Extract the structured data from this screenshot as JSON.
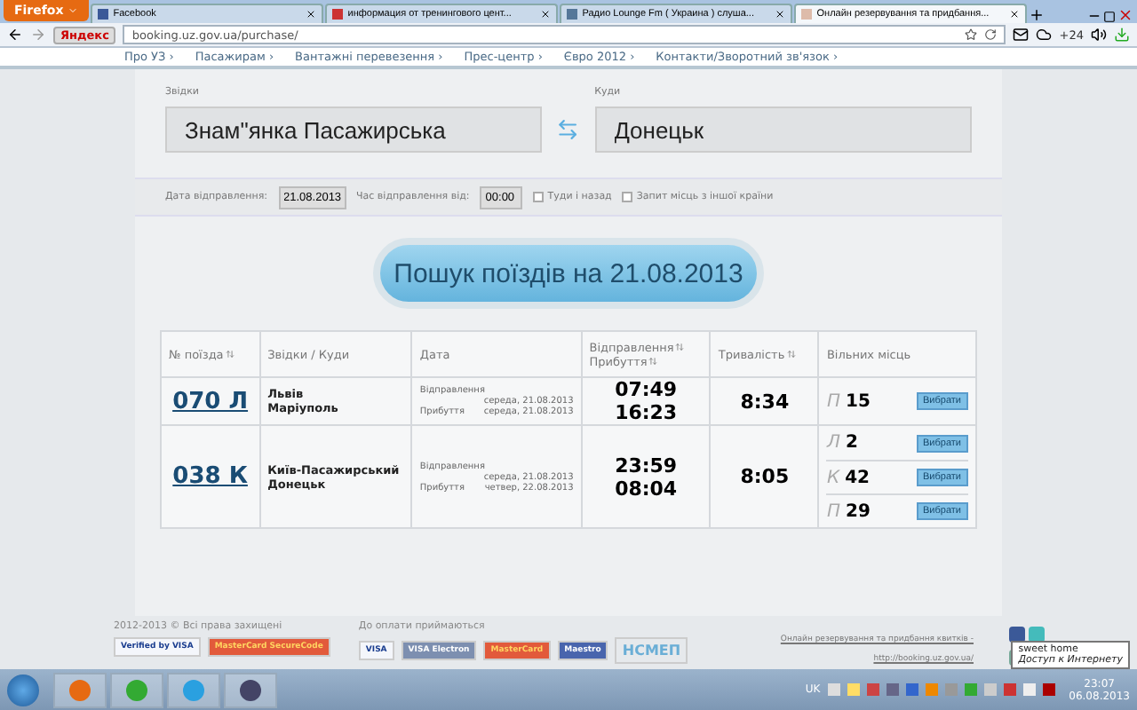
{
  "browser": {
    "menu_button": "Firefox",
    "tabs": [
      {
        "title": "Facebook",
        "selected": false
      },
      {
        "title": "информация от тренингового цент...",
        "selected": false
      },
      {
        "title": "Радио Lounge Fm ( Украина ) слуша...",
        "selected": false
      },
      {
        "title": "Онлайн резервування та придбання...",
        "selected": true
      }
    ],
    "search_engine": "Яндекс",
    "url": "booking.uz.gov.ua/purchase/",
    "weather": "+24"
  },
  "site_nav": [
    "Про УЗ ›",
    "Пасажирам ›",
    "Вантажні перевезення ›",
    "Прес-центр ›",
    "Євро 2012 ›",
    "Контакти/Зворотний зв'язок ›"
  ],
  "search_form": {
    "from_label": "Звідки",
    "from_value": "Знам\"янка Пасажирська",
    "to_label": "Куди",
    "to_value": "Донецьк",
    "date_label": "Дата відправлення:",
    "date_value": "21.08.2013",
    "time_label": "Час відправлення від:",
    "time_value": "00:00",
    "options": [
      {
        "label": "Туди і назад",
        "checked": false
      },
      {
        "label": "Запит місць з іншої країни",
        "checked": false
      }
    ],
    "search_button": "Пошук поїздів на 21.08.2013"
  },
  "table": {
    "columns": [
      {
        "lines": [
          {
            "text": "№ поїзда",
            "sortable": true
          }
        ]
      },
      {
        "lines": [
          {
            "text": "Звідки / Куди",
            "sortable": false
          }
        ]
      },
      {
        "lines": [
          {
            "text": "Дата",
            "sortable": false
          }
        ]
      },
      {
        "lines": [
          {
            "text": "Відправлення",
            "sortable": true
          },
          {
            "text": "Прибуття",
            "sortable": true
          }
        ]
      },
      {
        "lines": [
          {
            "text": "Тривалість",
            "sortable": true
          }
        ]
      },
      {
        "lines": [
          {
            "text": "Вільних місць",
            "sortable": false
          }
        ]
      }
    ],
    "rows": [
      {
        "train": "070 Л",
        "from": "Львів",
        "to": "Маріуполь",
        "departure_label": "Відправлення",
        "departure_date": "середа, 21.08.2013",
        "arrival_label": "Прибуття",
        "arrival_date": "середа, 21.08.2013",
        "departs": "07:49",
        "arrives": "16:23",
        "duration": "8:34",
        "seats": [
          {
            "class": "П",
            "count": "15",
            "button": "Вибрати"
          }
        ]
      },
      {
        "train": "038 К",
        "from": "Київ-Пасажирський",
        "to": "Донецьк",
        "departure_label": "Відправлення",
        "departure_date": "середа, 21.08.2013",
        "arrival_label": "Прибуття",
        "arrival_date": "четвер, 22.08.2013",
        "departs": "23:59",
        "arrives": "08:04",
        "duration": "8:05",
        "seats": [
          {
            "class": "Л",
            "count": "2",
            "button": "Вибрати"
          },
          {
            "class": "К",
            "count": "42",
            "button": "Вибрати"
          },
          {
            "class": "П",
            "count": "29",
            "button": "Вибрати"
          }
        ]
      }
    ]
  },
  "footer": {
    "copyright": "2012-2013 © Всі права захищені",
    "payment_label": "До оплати приймаються",
    "badges": [
      {
        "kind": "visa",
        "text": "Verified by VISA"
      },
      {
        "kind": "mastercard",
        "text": "MasterCard SecureCode"
      }
    ],
    "payments": [
      {
        "kind": "visa",
        "text": "VISA"
      },
      {
        "kind": "electron",
        "text": "VISA Electron"
      },
      {
        "kind": "mastercard",
        "text": "MasterCard"
      },
      {
        "kind": "maestro",
        "text": "Maestro"
      },
      {
        "kind": "nsmep",
        "text": "НСМЕП"
      }
    ],
    "links": [
      "Онлайн резервування та придбання квитків -",
      "http://booking.uz.gov.ua/"
    ]
  },
  "tooltip": {
    "title": "sweet home",
    "text": "Доступ к Интернету"
  },
  "taskbar": {
    "language": "UK",
    "time": "23:07",
    "date": "06.08.2013"
  }
}
